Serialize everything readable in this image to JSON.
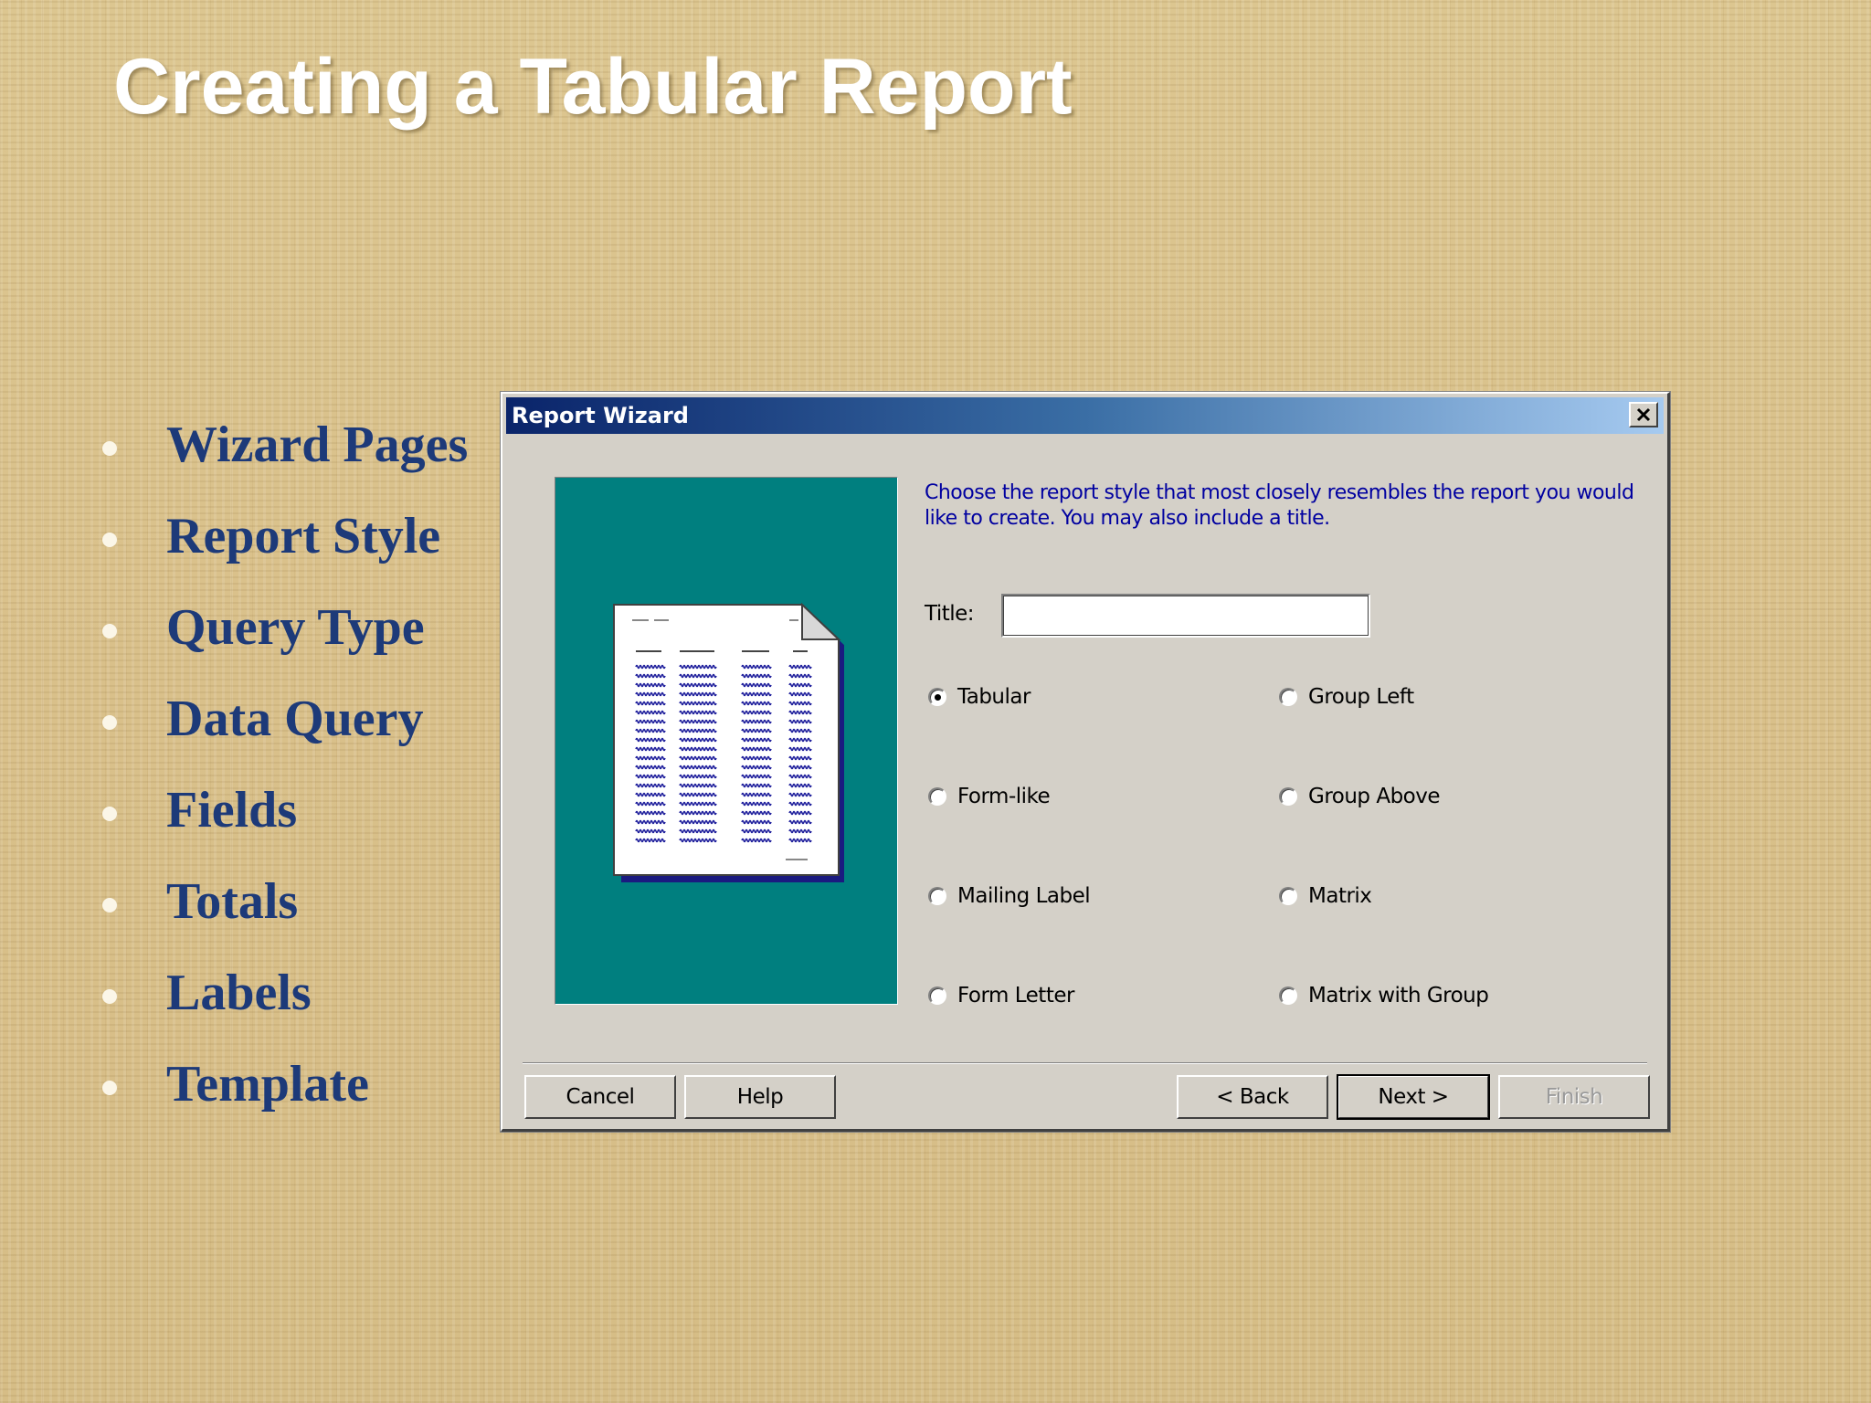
{
  "slide": {
    "title": "Creating a Tabular Report",
    "bullets": [
      "Wizard Pages",
      "Report Style",
      "Query Type",
      "Data Query",
      "Fields",
      "Totals",
      "Labels",
      "Template"
    ]
  },
  "dialog": {
    "title": "Report Wizard",
    "instructions": "Choose the report style that most closely resembles the report you would like to create. You may also include a title.",
    "title_label": "Title:",
    "title_value": "",
    "styles": [
      {
        "label": "Tabular",
        "selected": true
      },
      {
        "label": "Group Left",
        "selected": false
      },
      {
        "label": "Form-like",
        "selected": false
      },
      {
        "label": "Group Above",
        "selected": false
      },
      {
        "label": "Mailing Label",
        "selected": false
      },
      {
        "label": "Matrix",
        "selected": false
      },
      {
        "label": "Form Letter",
        "selected": false
      },
      {
        "label": "Matrix with Group",
        "selected": false
      }
    ],
    "buttons": {
      "cancel": "Cancel",
      "help": "Help",
      "back": "< Back",
      "next": "Next >",
      "finish": "Finish"
    }
  },
  "colors": {
    "title_text": "#ffffff",
    "bullet_text": "#1d3a79",
    "instruction_text": "#0000a0",
    "preview_background": "#007f7f",
    "dialog_face": "#d4d0c8",
    "titlebar_start": "#0a246a",
    "titlebar_end": "#a6caf0"
  },
  "icons": {
    "close": "close-icon",
    "preview": "tabular-report-preview-icon"
  }
}
